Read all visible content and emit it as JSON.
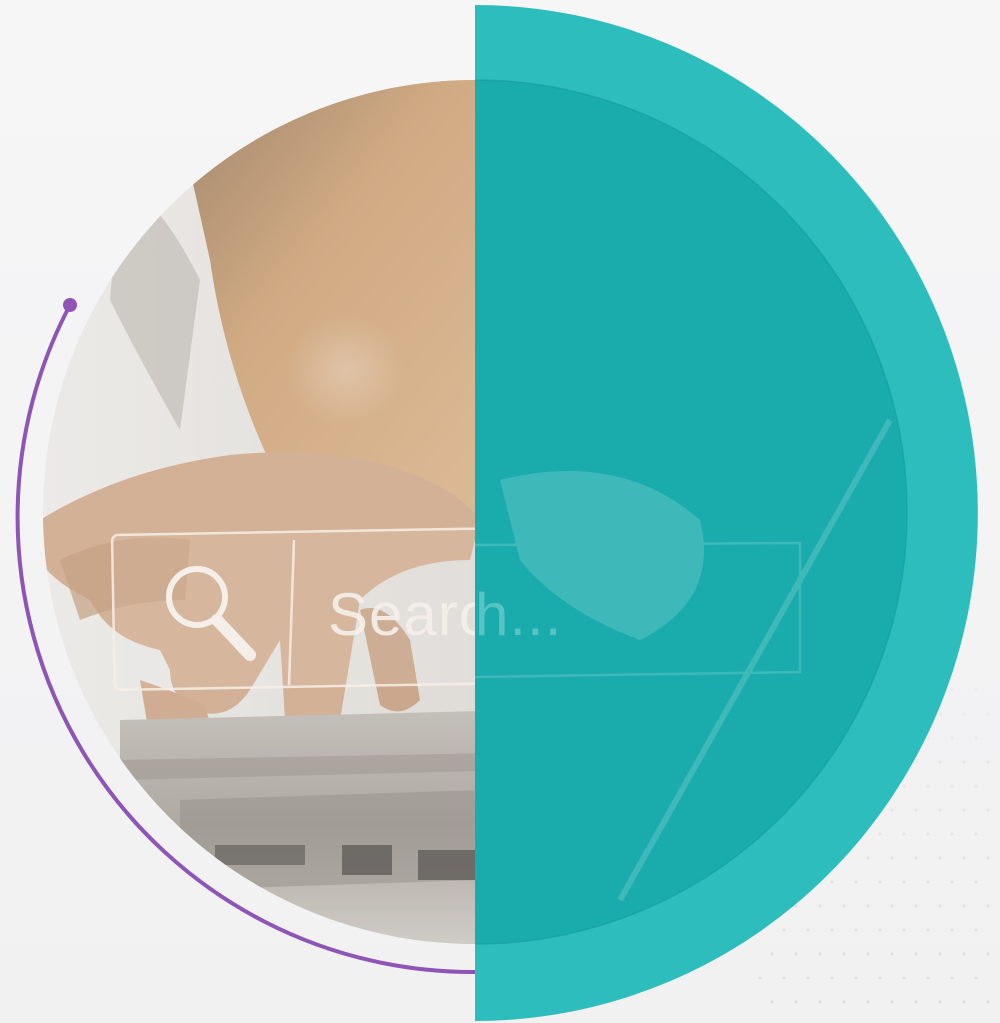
{
  "search_overlay": {
    "text": "Search...",
    "icon": "magnifier-icon"
  },
  "colors": {
    "background": "#f4f4f5",
    "teal_outer": "#2dbdbd",
    "teal_inner": "#1aabad",
    "accent_arc": "#8e55b7",
    "photo_skin": "#c89a76",
    "photo_sweater": "#b08455"
  }
}
